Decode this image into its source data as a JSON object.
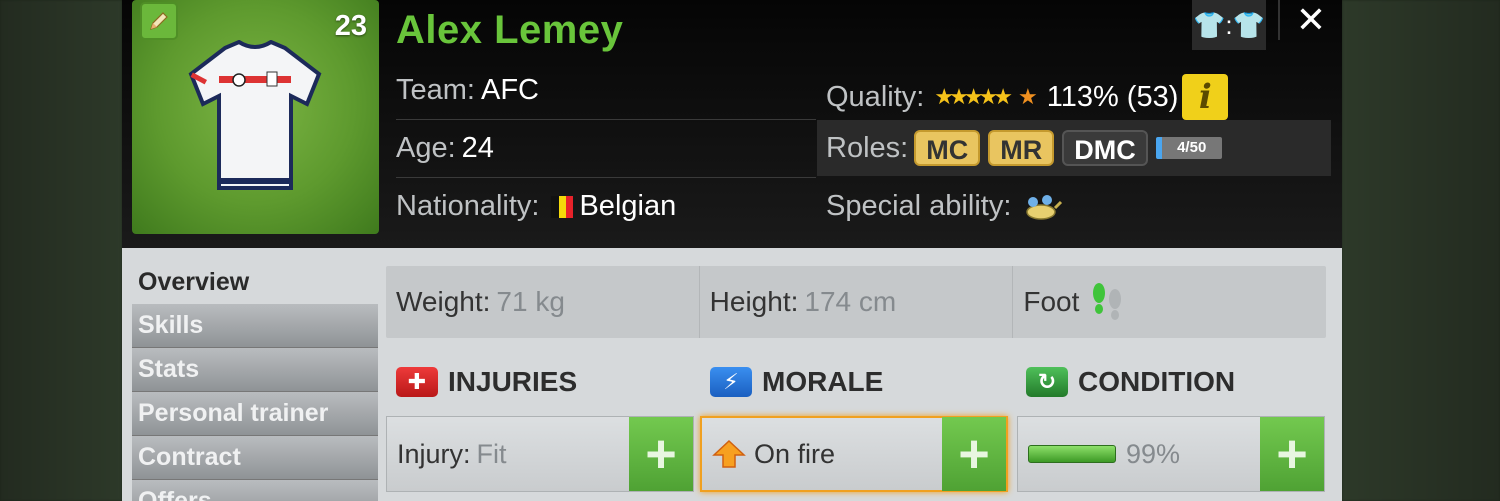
{
  "player": {
    "number": "23",
    "name": "Alex Lemey",
    "team_label": "Team:",
    "team": "AFC",
    "age_label": "Age:",
    "age": "24",
    "nationality_label": "Nationality:",
    "nationality": "Belgian",
    "quality_label": "Quality:",
    "quality_value": "113% (53)",
    "quality_stars": 4.5,
    "roles_label": "Roles:",
    "roles": [
      "MC",
      "MR",
      "DMC"
    ],
    "roles_progress": "4/50",
    "special_ability_label": "Special ability:"
  },
  "header_buttons": {
    "kit_icon": "shirt-swap-icon",
    "close": "✕",
    "info": "i"
  },
  "nav": {
    "items": [
      "Overview",
      "Skills",
      "Stats",
      "Personal trainer",
      "Contract",
      "Offers"
    ],
    "active": "Overview"
  },
  "physical": {
    "weight_label": "Weight:",
    "weight": "71 kg",
    "height_label": "Height:",
    "height": "174 cm",
    "foot_label": "Foot"
  },
  "sections": {
    "injuries": {
      "title": "INJURIES",
      "label": "Injury:",
      "value": "Fit"
    },
    "morale": {
      "title": "MORALE",
      "value": "On fire"
    },
    "condition": {
      "title": "CONDITION",
      "value": "99%",
      "level": 0.99
    }
  },
  "colors": {
    "name_green": "#69c53b",
    "plus_green": "#5fb33f",
    "star_gold": "#f5c21a",
    "info_yellow": "#f0d01a"
  }
}
